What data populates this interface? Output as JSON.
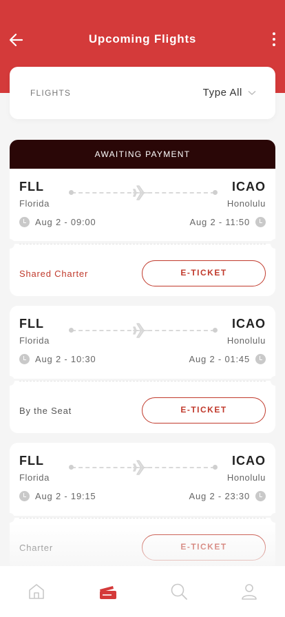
{
  "header": {
    "title": "Upcoming Flights",
    "back_icon": "arrow-left-icon",
    "menu_icon": "more-vertical-icon"
  },
  "filter": {
    "label": "FLIGHTS",
    "type_value": "Type All"
  },
  "colors": {
    "accent": "#d43a3a",
    "status_bar": "#2a0707",
    "button": "#c0392b"
  },
  "flights": [
    {
      "status": "AWAITING PAYMENT",
      "from_code": "FLL",
      "from_city": "Florida",
      "depart": "Aug 2 - 09:00",
      "to_code": "ICAO",
      "to_city": "Honolulu",
      "arrive": "Aug 2 - 11:50",
      "charter_type": "Shared Charter",
      "ticket_label": "E-TICKET"
    },
    {
      "from_code": "FLL",
      "from_city": "Florida",
      "depart": "Aug 2 - 10:30",
      "to_code": "ICAO",
      "to_city": "Honolulu",
      "arrive": "Aug 2 - 01:45",
      "charter_type": "By the Seat",
      "ticket_label": "E-TICKET"
    },
    {
      "from_code": "FLL",
      "from_city": "Florida",
      "depart": "Aug 2 - 19:15",
      "to_code": "ICAO",
      "to_city": "Honolulu",
      "arrive": "Aug 2 - 23:30",
      "charter_type": "Charter",
      "ticket_label": "E-TICKET"
    }
  ],
  "tabs": [
    {
      "icon": "home-icon",
      "active": false
    },
    {
      "icon": "ticket-icon",
      "active": true
    },
    {
      "icon": "search-icon",
      "active": false
    },
    {
      "icon": "profile-icon",
      "active": false
    }
  ]
}
